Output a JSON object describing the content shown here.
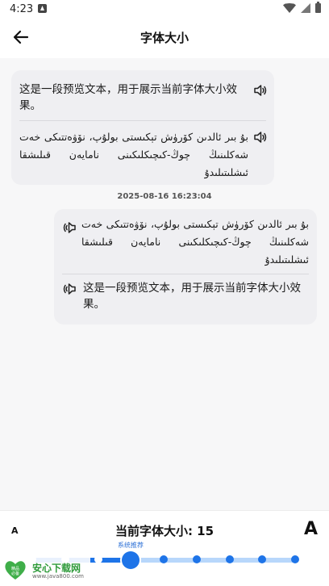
{
  "status_bar": {
    "time": "4:23"
  },
  "header": {
    "title": "字体大小"
  },
  "messages": {
    "left": {
      "zh_text": "这是一段预览文本，用于展示当前字体大小效果。",
      "ug_text": "بۇ بىر ئالدىن كۆرۈش تېكىستى بولۇپ، نۆۋەتتىكى خەت شەكلىنىڭ چوڭ-كىچىكلىكىنى نامايەن قىلىشقا ئىشلىتىلىدۇ"
    },
    "timestamp": "2025-08-16 16:23:04",
    "right": {
      "ug_text": "بۇ بىر ئالدىن كۆرۈش تېكىستى بولۇپ، نۆۋەتتىكى خەت شەكلىنىڭ چوڭ-كىچىكلىكىنى نامايەن قىلىشقا ئىشلىتىلىدۇ",
      "zh_text": "这是一段预览文本，用于展示当前字体大小效果。"
    }
  },
  "font_control": {
    "small_label": "A",
    "large_label": "A",
    "current_label": "当前字体大小: 15",
    "recommend_label": "系统推荐",
    "steps": 9,
    "current_step": 3,
    "recommended_step": 3
  },
  "watermark": {
    "title": "安心下载网",
    "url": "www.java800.com",
    "badge": "精品\n必备"
  },
  "colors": {
    "accent": "#1e74e8",
    "track": "#b8d7fb",
    "bubble": "#efeff2",
    "background": "#f7f7f8"
  },
  "icons": {
    "back": "arrow-left-icon",
    "speaker": "speaker-icon"
  }
}
